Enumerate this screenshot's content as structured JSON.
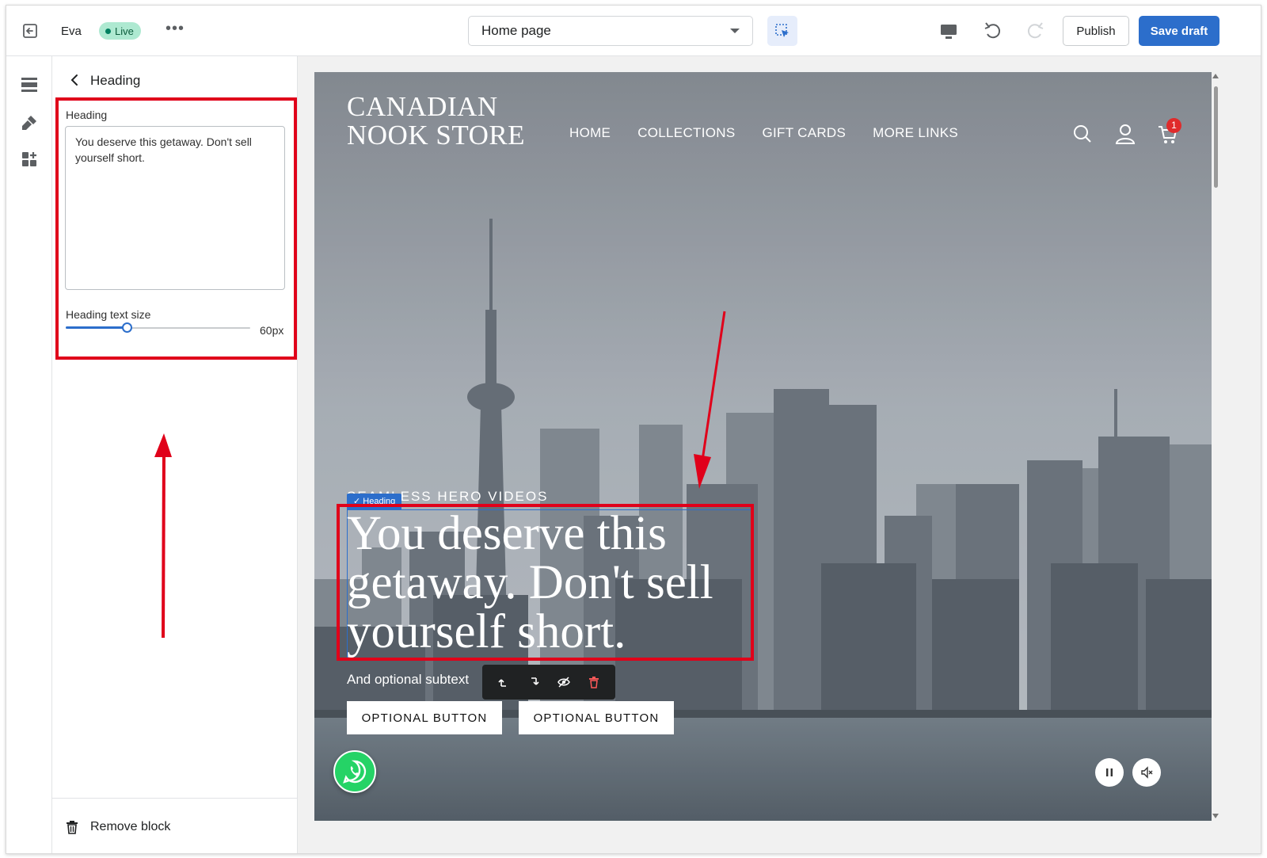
{
  "topbar": {
    "theme_name": "Eva",
    "live_label": "Live",
    "more_label": "•••",
    "page_select": "Home page",
    "publish_label": "Publish",
    "save_label": "Save draft"
  },
  "panel": {
    "title": "Heading",
    "field_label": "Heading",
    "heading_value": "You deserve this getaway. Don't sell yourself short.",
    "size_label": "Heading text size",
    "size_value": "60px",
    "size_fraction": 0.33,
    "remove_label": "Remove block"
  },
  "preview": {
    "logo": "CANADIAN NOOK STORE",
    "nav": [
      "HOME",
      "COLLECTIONS",
      "GIFT CARDS",
      "MORE LINKS"
    ],
    "cart_count": "1",
    "eyebrow": "SEAMLESS HERO VIDEOS",
    "heading_tag": "✓ Heading",
    "heading": "You deserve this getaway. Don't sell yourself short.",
    "subtext": "And optional subtext",
    "button_1": "OPTIONAL BUTTON",
    "button_2": "OPTIONAL BUTTON"
  },
  "colors": {
    "accent": "#2c6ecb",
    "live_bg": "#aee9d1",
    "annotation": "#e0001a",
    "cart_badge": "#e02b2b",
    "whatsapp": "#25d366"
  },
  "icons": {
    "topbar": [
      "exit-icon",
      "more-icon",
      "chevron-down-icon",
      "inspector-icon",
      "desktop-icon",
      "undo-icon",
      "redo-icon"
    ],
    "rail": [
      "sections-icon",
      "theme-settings-icon",
      "app-embeds-icon"
    ],
    "preview": [
      "search-icon",
      "account-icon",
      "cart-icon",
      "whatsapp-icon",
      "pause-icon",
      "mute-icon"
    ],
    "block_toolbar": [
      "move-up-icon",
      "move-down-icon",
      "hide-icon",
      "delete-icon"
    ]
  }
}
